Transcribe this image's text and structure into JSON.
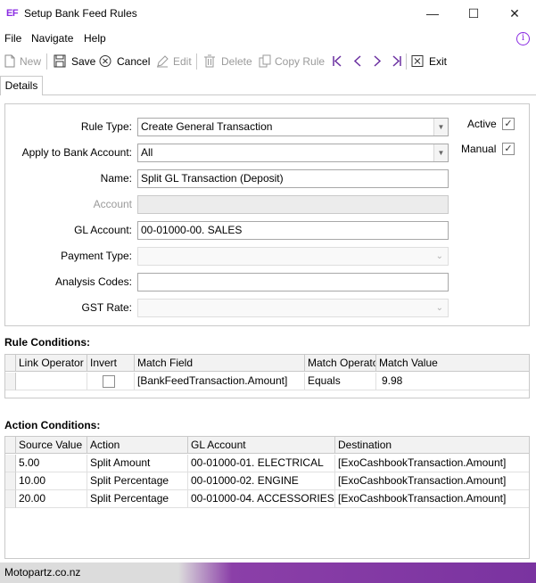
{
  "window": {
    "logo": "EF",
    "title": "Setup Bank Feed Rules",
    "minimize": "—",
    "maximize": "☐",
    "close": "✕"
  },
  "menu": {
    "items": [
      "File",
      "Navigate",
      "Help"
    ],
    "info_icon": "i"
  },
  "toolbar": {
    "new": "New",
    "save": "Save",
    "cancel": "Cancel",
    "edit": "Edit",
    "delete": "Delete",
    "copy_rule": "Copy Rule",
    "exit": "Exit"
  },
  "tabs": [
    "Details"
  ],
  "form": {
    "rule_type": {
      "label": "Rule Type:",
      "value": "Create General Transaction"
    },
    "apply_to_bank": {
      "label": "Apply to Bank Account:",
      "value": "All"
    },
    "name": {
      "label": "Name:",
      "value": "Split GL Transaction (Deposit)"
    },
    "account": {
      "label": "Account",
      "value": ""
    },
    "gl_account": {
      "label": "GL Account:",
      "value": "00-01000-00. SALES"
    },
    "payment_type": {
      "label": "Payment Type:",
      "value": ""
    },
    "analysis_codes": {
      "label": "Analysis Codes:",
      "value": ""
    },
    "gst_rate": {
      "label": "GST Rate:",
      "value": ""
    },
    "active": {
      "label": "Active",
      "checked": true,
      "mark": "✓"
    },
    "manual": {
      "label": "Manual",
      "checked": true,
      "mark": "✓"
    }
  },
  "rule_conditions": {
    "title": "Rule Conditions:",
    "columns": [
      "Link Operator",
      "Invert",
      "Match Field",
      "Match Operator",
      "Match Value"
    ],
    "rows": [
      {
        "link_operator": "",
        "invert": false,
        "match_field": "[BankFeedTransaction.Amount]",
        "match_operator": "Equals",
        "match_value": "9.98"
      }
    ]
  },
  "action_conditions": {
    "title": "Action Conditions:",
    "columns": [
      "Source Value",
      "Action",
      "GL Account",
      "Destination"
    ],
    "rows": [
      {
        "source_value": "5.00",
        "action": "Split Amount",
        "gl_account": "00-01000-01. ELECTRICAL",
        "destination": "[ExoCashbookTransaction.Amount]"
      },
      {
        "source_value": "10.00",
        "action": "Split Percentage",
        "gl_account": "00-01000-02. ENGINE",
        "destination": "[ExoCashbookTransaction.Amount]"
      },
      {
        "source_value": "20.00",
        "action": "Split Percentage",
        "gl_account": "00-01000-04. ACCESSORIES",
        "destination": "[ExoCashbookTransaction.Amount]"
      }
    ]
  },
  "status": {
    "text": "Motopartz.co.nz"
  },
  "colors": {
    "accent": "#8a2be2",
    "status_gradient_end": "#7a33a0"
  }
}
